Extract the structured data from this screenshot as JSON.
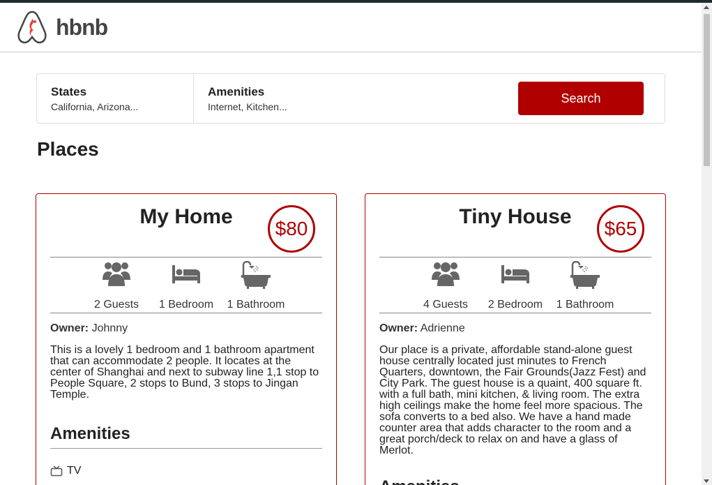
{
  "header": {
    "logo_text": "hbnb"
  },
  "filters": {
    "states": {
      "title": "States",
      "subtitle": "California, Arizona..."
    },
    "amenities": {
      "title": "Amenities",
      "subtitle": "Internet, Kitchen..."
    },
    "search_label": "Search"
  },
  "places_title": "Places",
  "places": [
    {
      "name": "My Home",
      "price": "$80",
      "guests": "2 Guests",
      "bedrooms": "1 Bedroom",
      "bathrooms": "1 Bathroom",
      "owner_label": "Owner:",
      "owner": "Johnny",
      "description": "This is a lovely 1 bedroom and 1 bathroom apartment that can accommodate 2 people. It locates at the center of Shanghai and next to subway line 1,1 stop to People Square, 2 stops to Bund, 3 stops to Jingan Temple.",
      "amenities_title": "Amenities",
      "amenities": [
        "TV"
      ]
    },
    {
      "name": "Tiny House",
      "price": "$65",
      "guests": "4 Guests",
      "bedrooms": "2 Bedroom",
      "bathrooms": "1 Bathroom",
      "owner_label": "Owner:",
      "owner": "Adrienne",
      "description": "Our place is a private, affordable stand-alone guest house centrally located just minutes to French Quarters, downtown, the Fair Grounds(Jazz Fest) and City Park. The guest house is a quaint, 400 square ft. with a full bath, mini kitchen, & living room. The extra high ceilings make the home feel more spacious. The sofa converts to a bed also. We have a hand made counter area that adds character to the room and a great porch/deck to relax on and have a glass of Merlot.",
      "amenities_title": "Amenities"
    }
  ],
  "colors": {
    "accent": "#b00000",
    "icon_gray": "#666666",
    "text": "#222222"
  },
  "icons": {
    "logo": "airbnb-logo-icon",
    "guests": "users-icon",
    "bedroom": "bed-icon",
    "bathroom": "bathtub-icon",
    "tv": "tv-icon"
  }
}
